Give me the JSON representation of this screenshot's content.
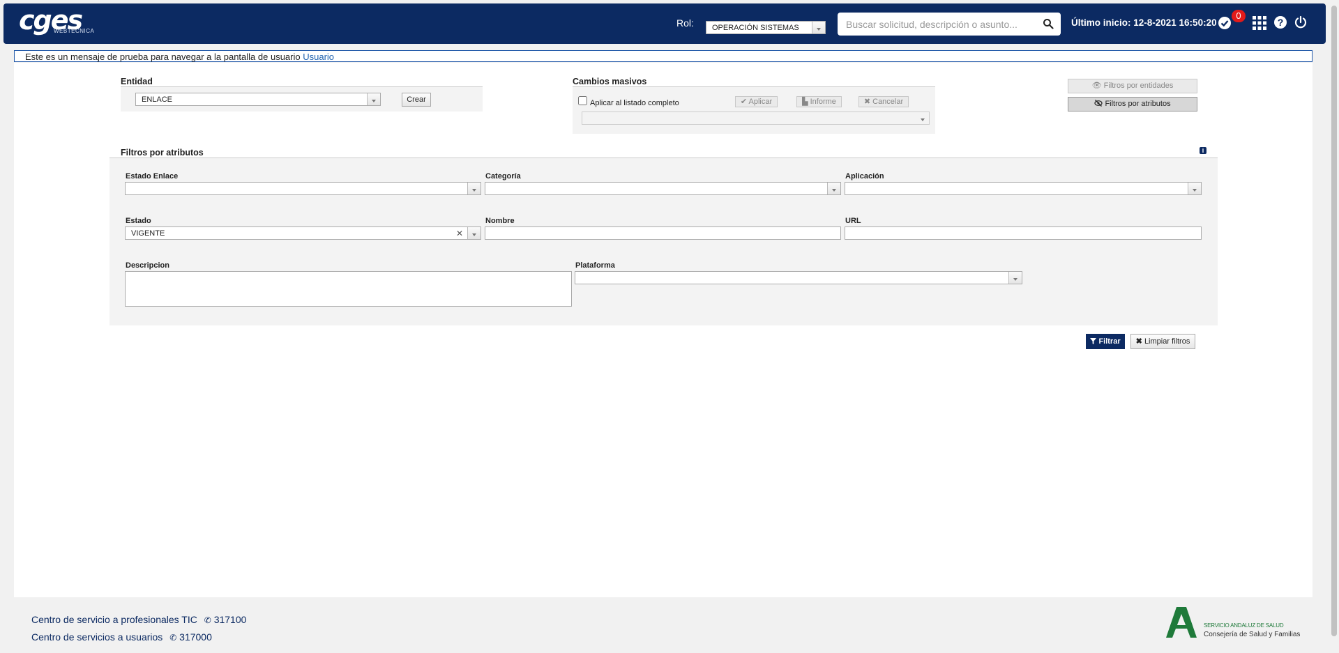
{
  "header": {
    "logo_main": "cges",
    "logo_sub": "WEBTECNICA",
    "rol_label": "Rol:",
    "rol_value": "OPERACIÓN SISTEMAS",
    "search_placeholder": "Buscar solicitud, descripción o asunto...",
    "last_login": "Último inicio: 12-8-2021 16:50:20",
    "notifications_count": "0"
  },
  "message": {
    "text": "Este es un mensaje de prueba para navegar a la pantalla de usuario ",
    "link": "Usuario"
  },
  "entidad": {
    "label": "Entidad",
    "value": "ENLACE",
    "create_button": "Crear"
  },
  "cambios": {
    "label": "Cambios masivos",
    "checkbox_label": "Aplicar al listado completo",
    "apply_button": "Aplicar",
    "report_button": "Informe",
    "cancel_button": "Cancelar"
  },
  "toggles": {
    "entities": "Filtros por entidades",
    "attributes": "Filtros por atributos"
  },
  "filters": {
    "title": "Filtros por atributos",
    "estado_enlace": "Estado Enlace",
    "categoria": "Categoría",
    "aplicacion": "Aplicación",
    "estado": "Estado",
    "estado_value": "VIGENTE",
    "nombre": "Nombre",
    "url": "URL",
    "descripcion": "Descripcion",
    "plataforma": "Plataforma"
  },
  "actions": {
    "filter_button": "Filtrar",
    "clear_button": "Limpiar filtros"
  },
  "footer": {
    "line1": "Centro de servicio a profesionales TIC",
    "phone1": "317100",
    "line2": "Centro de servicios a usuarios",
    "phone2": "317000",
    "org_line1": "SERVICIO ANDALUZ DE SALUD",
    "org_line2": "Consejería de Salud y Familias"
  },
  "colors": {
    "header_bg": "#0c2a62",
    "badge": "#e21a1a",
    "link": "#1f62b0",
    "sas_green": "#1f7a3a"
  }
}
